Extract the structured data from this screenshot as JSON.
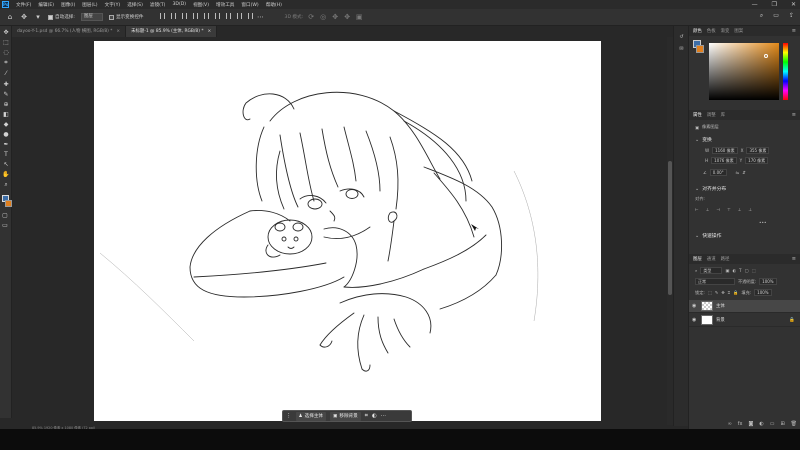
{
  "menu": {
    "logo": "Ps",
    "items": [
      "文件(F)",
      "编辑(E)",
      "图像(I)",
      "图层(L)",
      "文字(Y)",
      "选择(S)",
      "滤镜(T)",
      "3D(D)",
      "视图(V)",
      "增效工具",
      "窗口(W)",
      "帮助(H)"
    ],
    "window_buttons": [
      "—",
      "❐",
      "✕"
    ]
  },
  "options": {
    "auto_select_label": "自动选择:",
    "auto_select_value": "图层",
    "transform_label": "显示变换控件",
    "mode_3d": "3D 模式:"
  },
  "tabs": [
    {
      "label": "dayoo-Y-1.psd @ 66.7% (人物 横图, RGB/8) *",
      "close": "×"
    },
    {
      "label": "未标题-1 @ 85.9% (主体, RGB/8) *",
      "close": "×"
    }
  ],
  "context_bar": {
    "select_subject": "选择主体",
    "remove_bg": "移除背景"
  },
  "status": "85.9%   1920 像素 x 1080 像素 (72 ppi)",
  "color_panel": {
    "tabs": [
      "颜色",
      "色板",
      "渐变",
      "图案"
    ],
    "fg": "#3d6ea8",
    "bg": "#e07f1e"
  },
  "properties_panel": {
    "tabs": [
      "属性",
      "调整",
      "库"
    ],
    "layer_kind": "像素图层",
    "transform_title": "变换",
    "w_label": "W",
    "w_value": "1160 像素",
    "x_label": "X",
    "x_value": "355 像素",
    "h_label": "H",
    "h_value": "1076 像素",
    "y_label": "Y",
    "y_value": "170 像素",
    "angle_value": "0.00°",
    "align_title": "对齐并分布",
    "align_sub": "对齐:",
    "more": "•••",
    "quick_actions": "快速操作"
  },
  "layers_panel": {
    "tabs": [
      "图层",
      "通道",
      "路径"
    ],
    "filter_label": "类型",
    "blend_mode": "正常",
    "opacity_label": "不透明度:",
    "opacity_value": "100%",
    "lock_label": "锁定:",
    "fill_label": "填充:",
    "fill_value": "100%",
    "layers": [
      {
        "name": "主体",
        "selected": true
      },
      {
        "name": "背景",
        "selected": false
      }
    ]
  },
  "colors": {
    "ui_bg": "#282828",
    "panel": "#323232",
    "accent": "#31a8ff"
  }
}
